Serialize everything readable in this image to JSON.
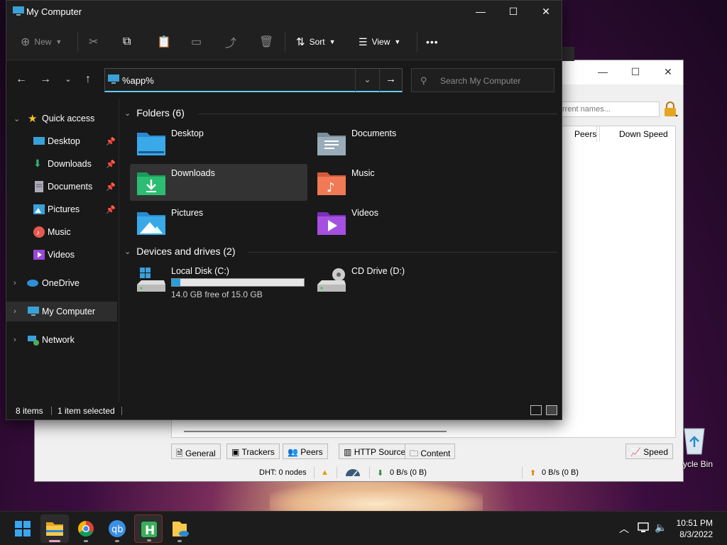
{
  "explorer": {
    "title": "My Computer",
    "toolbar": {
      "new_label": "New",
      "sort_label": "Sort",
      "view_label": "View",
      "more_label": "•••"
    },
    "address": "%app%",
    "search_placeholder": "Search My Computer",
    "nav": {
      "quick_access": "Quick access",
      "items": [
        {
          "label": "Desktop"
        },
        {
          "label": "Downloads"
        },
        {
          "label": "Documents"
        },
        {
          "label": "Pictures"
        },
        {
          "label": "Music"
        },
        {
          "label": "Videos"
        }
      ],
      "onedrive": "OneDrive",
      "my_computer": "My Computer",
      "network": "Network"
    },
    "folders_header": "Folders (6)",
    "folders": [
      {
        "name": "Desktop"
      },
      {
        "name": "Documents"
      },
      {
        "name": "Downloads"
      },
      {
        "name": "Music"
      },
      {
        "name": "Pictures"
      },
      {
        "name": "Videos"
      }
    ],
    "devices_header": "Devices and drives (2)",
    "drives": [
      {
        "name": "Local Disk (C:)",
        "free": "14.0 GB free of 15.0 GB",
        "used_fraction": 0.067
      },
      {
        "name": "CD Drive (D:)"
      }
    ],
    "status": {
      "items": "8 items",
      "selected": "1 item selected"
    }
  },
  "background_app": {
    "filter_placeholder": "rrent names...",
    "columns": [
      "Peers",
      "Down Speed"
    ],
    "tabs": [
      "General",
      "Trackers",
      "Peers",
      "HTTP Sources",
      "Content"
    ],
    "speed_tab": "Speed",
    "status": {
      "dht": "DHT: 0 nodes",
      "down": "0 B/s (0 B)",
      "up": "0 B/s (0 B)"
    }
  },
  "desktop": {
    "recycle_label": "ycle Bin"
  },
  "taskbar": {
    "time": "10:51 PM",
    "date": "8/3/2022"
  },
  "colors": {
    "accent": "#60cdff",
    "drive_fill": "#26a0da",
    "explorer_bg": "#191919"
  }
}
